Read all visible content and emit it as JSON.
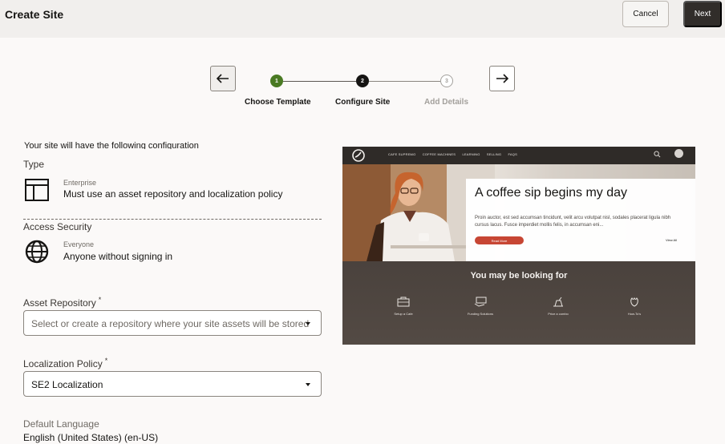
{
  "header": {
    "title": "Create Site",
    "cancel_label": "Cancel",
    "next_label": "Next"
  },
  "stepper": {
    "back_icon": "arrow-left-icon",
    "forward_icon": "arrow-right-icon",
    "steps": [
      {
        "number": "1",
        "label": "Choose Template",
        "state": "complete"
      },
      {
        "number": "2",
        "label": "Configure Site",
        "state": "current"
      },
      {
        "number": "3",
        "label": "Add Details",
        "state": "pending"
      }
    ]
  },
  "config": {
    "intro": "Your site will have the following configuration",
    "type": {
      "title": "Type",
      "icon": "layout-icon",
      "name": "Enterprise",
      "description": "Must use an asset repository and localization policy"
    },
    "access": {
      "title": "Access Security",
      "icon": "globe-icon",
      "name": "Everyone",
      "description": "Anyone without signing in"
    }
  },
  "form": {
    "asset_repository": {
      "label": "Asset Repository",
      "required_mark": "*",
      "placeholder": "Select or create a repository where your site assets will be stored"
    },
    "localization_policy": {
      "label": "Localization Policy",
      "required_mark": "*",
      "value": "SE2 Localization"
    },
    "default_language": {
      "label": "Default Language",
      "value": "English (United States) (en-US)"
    }
  },
  "preview": {
    "nav": [
      "CAFE SUPREMO",
      "COFFEE MACHINES",
      "LEARNING",
      "SELLING",
      "FAQS"
    ],
    "hero_title": "A coffee sip begins my day",
    "hero_body": "Proin auctor, est sed accumsan tincidunt, velit arcu volutpat nisl, sodales placerat ligula nibh cursus lacus. Fusce imperdiet mollis felis, in accumsan eni...",
    "read_more": "Read More",
    "view_all": "View All",
    "looking_for": "You may be looking for",
    "items": [
      {
        "label": "Setup a Cafe",
        "icon": "cafe-icon"
      },
      {
        "label": "Funding Solutions",
        "icon": "money-icon"
      },
      {
        "label": "Price a combo",
        "icon": "coffee-pot-icon"
      },
      {
        "label": "How-To's",
        "icon": "leaf-icon"
      }
    ],
    "colors": {
      "accent": "#c74634",
      "nav_bg": "#2f2b28",
      "bottom_bg": "#4a423d"
    }
  },
  "colors": {
    "step_complete": "#4a7a23",
    "step_current": "#161513",
    "next_button": "#312d2a"
  }
}
